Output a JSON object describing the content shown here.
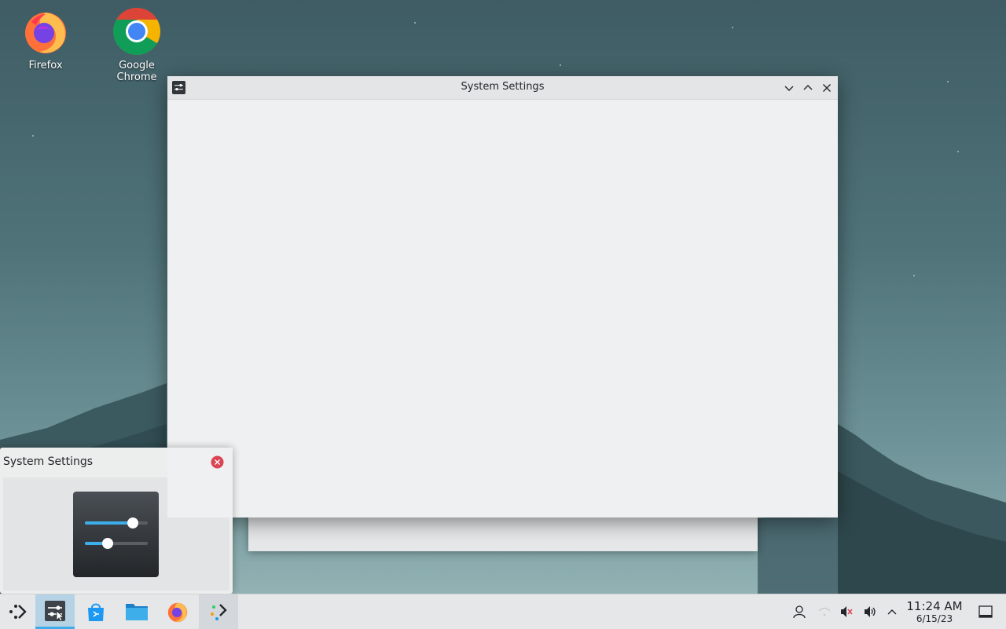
{
  "desktop": {
    "icons": [
      {
        "label": "Firefox",
        "icon": "firefox-icon"
      },
      {
        "label": "Google Chrome",
        "icon": "chrome-icon"
      }
    ]
  },
  "window": {
    "title": "System Settings",
    "controls": [
      "minimize",
      "maximize",
      "close"
    ]
  },
  "preview": {
    "title": "System Settings"
  },
  "taskbar": {
    "launcher": "application-launcher-icon",
    "tasks": [
      {
        "name": "System Settings",
        "icon": "system-settings-icon",
        "active": true
      },
      {
        "name": "Discover",
        "icon": "discover-icon"
      },
      {
        "name": "Dolphin",
        "icon": "folder-icon"
      },
      {
        "name": "Firefox",
        "icon": "firefox-icon"
      },
      {
        "name": "Kickoff",
        "icon": "overflow-icon"
      }
    ],
    "tray": [
      "user-icon",
      "network-icon",
      "microphone-muted-icon",
      "volume-icon",
      "expand-tray-icon"
    ],
    "clock": {
      "time": "11:24 AM",
      "date": "6/15/23"
    },
    "show_desktop": "show-desktop-icon"
  },
  "colors": {
    "accent": "#3daee9",
    "close_red": "#da4453",
    "window_bg": "#eff0f1"
  }
}
